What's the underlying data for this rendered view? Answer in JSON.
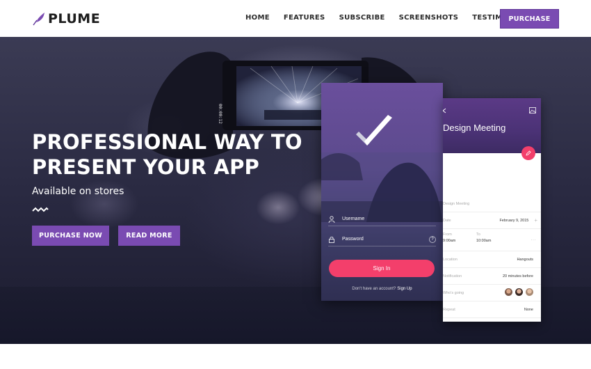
{
  "brand": {
    "name": "PLUME",
    "accent": "#7a4bb2"
  },
  "nav": {
    "links": [
      "HOME",
      "FEATURES",
      "SUBSCRIBE",
      "SCREENSHOTS",
      "TESTIMONIALS"
    ],
    "cta": "PURCHASE"
  },
  "hero": {
    "title_line1": "PROFESSIONAL WAY TO",
    "title_line2": "PRESENT YOUR APP",
    "subtitle": "Available on stores",
    "primary_button": "PURCHASE NOW",
    "secondary_button": "READ MORE",
    "camera_timer": "00:00:12"
  },
  "login_screen": {
    "username_placeholder": "Username",
    "password_placeholder": "Password",
    "help_icon": "?",
    "signin_label": "Sign In",
    "footer_text": "Don't have an account?",
    "footer_link": "Sign Up",
    "button_color": "#f33f6b"
  },
  "event_screen": {
    "title": "Design Meeting",
    "rows": {
      "name": "Design Meeting",
      "date_label": "Date",
      "date_value": "February 9, 2015",
      "from_label": "From",
      "from_value": "9:00am",
      "to_label": "To",
      "to_value": "10:00am",
      "location_label": "Location",
      "location_value": "Hangouts",
      "notification_label": "Notification",
      "notification_value": "20 minutes before",
      "going_label": "Who's going",
      "repeat_label": "Repeat",
      "repeat_value": "None"
    }
  }
}
